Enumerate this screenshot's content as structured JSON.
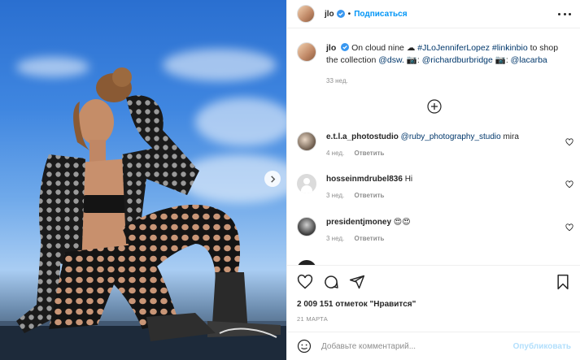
{
  "post": {
    "username": "jlo",
    "follow_label": "Подписаться",
    "caption": {
      "username": "jlo",
      "text_start": "On cloud nine ",
      "cloud_emoji": "☁",
      "tags": "#JLoJenniferLopez #linkinbio",
      "text_mid": " to shop the collection ",
      "mention_1": "@dsw.",
      "camera_1": " 📷: ",
      "mention_2": "@richardburbridge",
      "camera_2": " 📷: ",
      "mention_3": "@lacarba",
      "time": "33 нед."
    },
    "comments": [
      {
        "username": "e.t.l.a_photostudio",
        "mention": "@ruby_photography_studio",
        "text": " mira",
        "time": "4 нед.",
        "reply": "Ответить"
      },
      {
        "username": "hosseinmdrubel836",
        "mention": "",
        "text": " Hi",
        "time": "3 нед.",
        "reply": "Ответить"
      },
      {
        "username": "presidentjmoney",
        "mention": "",
        "text": " 😍😍",
        "time": "3 нед.",
        "reply": "Ответить"
      }
    ],
    "likes": "2 009 151 отметок \"Нравится\"",
    "date": "21 МАРТА",
    "comment_placeholder": "Добавьте комментарий...",
    "publish_label": "Опубликовать"
  },
  "icons": {
    "more": "more-options-icon",
    "verified": "verified-badge-icon",
    "load_more": "load-more-comments-icon",
    "like": "heart-icon",
    "comment": "comment-icon",
    "share": "share-icon",
    "save": "bookmark-icon",
    "emoji": "emoji-icon",
    "next": "chevron-right-icon"
  },
  "colors": {
    "accent": "#0095f6",
    "link": "#00376b",
    "muted": "#8e8e8e",
    "publish_disabled": "#b2dffc",
    "verified": "#3897f0"
  }
}
